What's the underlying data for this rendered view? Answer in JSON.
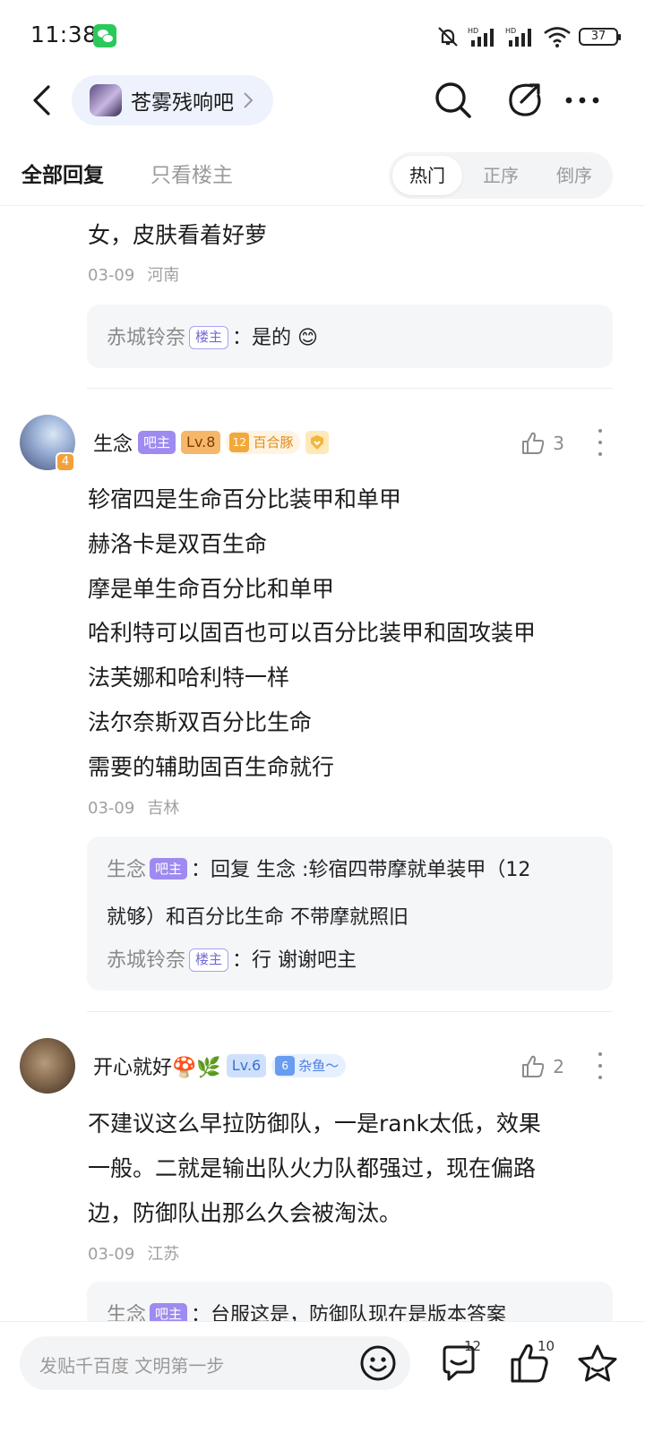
{
  "status_bar": {
    "time": "11:38",
    "battery": "37"
  },
  "nav": {
    "forum_name": "苍雾残响吧"
  },
  "tabs": {
    "all": "全部回复",
    "op_only": "只看楼主",
    "sort": [
      "热门",
      "正序",
      "倒序"
    ]
  },
  "partial_post": {
    "text": "女，皮肤看着好萝",
    "date": "03-09",
    "location": "河南",
    "replies": [
      {
        "name": "赤城铃奈",
        "tag": "楼主",
        "text": "：是的 😊"
      }
    ]
  },
  "posts": [
    {
      "username": "生念",
      "mod_badge": "吧主",
      "level": "Lv.8",
      "title_num": "12",
      "title": "百合豚",
      "likes": "3",
      "lines": [
        "轸宿四是生命百分比装甲和单甲",
        "赫洛卡是双百生命",
        "摩是单生命百分比和单甲",
        "哈利特可以固百也可以百分比装甲和固攻装甲",
        "法芙娜和哈利特一样",
        "法尔奈斯双百分比生命",
        "需要的辅助固百生命就行"
      ],
      "date": "03-09",
      "location": "吉林",
      "avatar_level": "4",
      "replies": [
        {
          "name": "生念",
          "tag": "吧主",
          "text": "：回复 生念 :轸宿四带摩就单装甲（12",
          "text2": "就够）和百分比生命 不带摩就照旧"
        },
        {
          "name": "赤城铃奈",
          "tag": "楼主",
          "text": "：行 谢谢吧主"
        }
      ]
    },
    {
      "username": "开心就好🍄🌿",
      "level": "Lv.6",
      "title_num": "6",
      "title": "杂鱼～",
      "likes": "2",
      "lines": [
        "不建议这么早拉防御队，一是rank太低，效果",
        "一般。二就是输出队火力队都强过，现在偏路",
        "边，防御队出那么久会被淘汰。"
      ],
      "date": "03-09",
      "location": "江苏",
      "replies": [
        {
          "name": "生念",
          "tag": "吧主",
          "text": "：台服这是，防御队现在是版本答案"
        }
      ]
    }
  ],
  "bottom": {
    "placeholder": "发贴千百度 文明第一步",
    "comment_count": "12",
    "like_count": "10"
  }
}
